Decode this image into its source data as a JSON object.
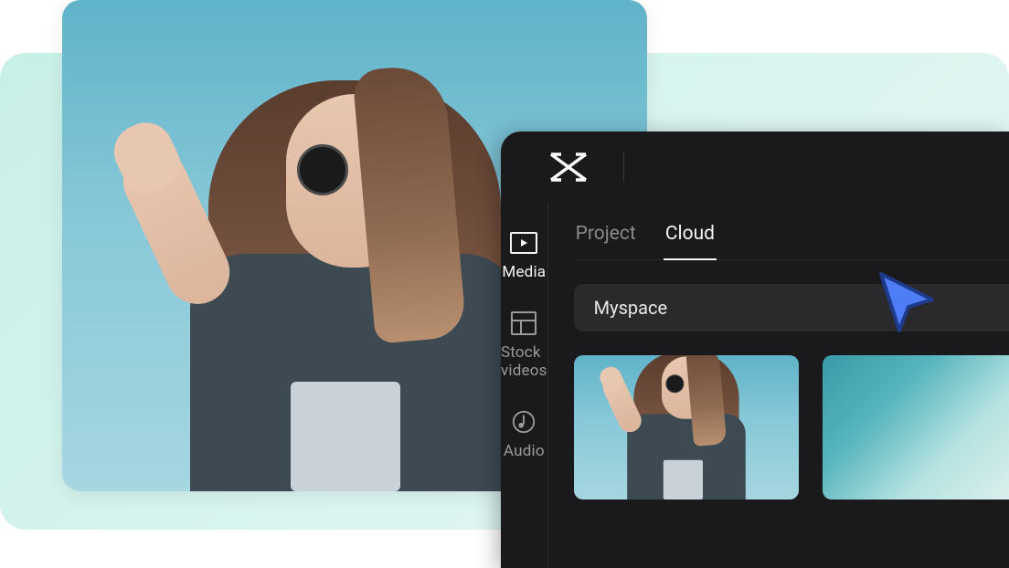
{
  "sidebar": {
    "items": [
      {
        "label": "Media",
        "icon": "media-icon",
        "active": true
      },
      {
        "label": "Stock videos",
        "icon": "stock-videos-icon",
        "active": false
      },
      {
        "label": "Audio",
        "icon": "audio-icon",
        "active": false
      }
    ]
  },
  "tabs": [
    {
      "label": "Project",
      "active": false
    },
    {
      "label": "Cloud",
      "active": true
    }
  ],
  "folder": {
    "name": "Myspace"
  },
  "thumbnails": [
    {
      "name": "clip-person"
    },
    {
      "name": "clip-ice"
    }
  ]
}
